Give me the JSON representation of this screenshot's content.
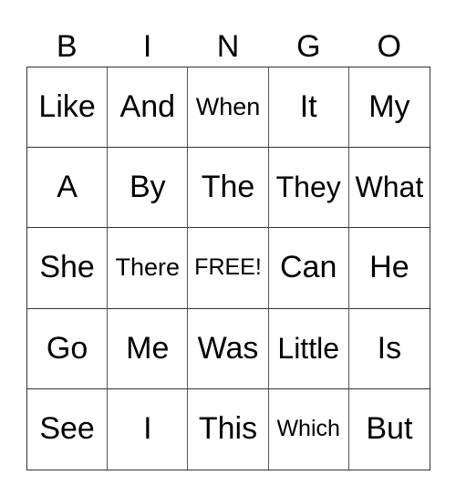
{
  "header": [
    "B",
    "I",
    "N",
    "G",
    "O"
  ],
  "cells": [
    [
      "Like",
      "And",
      "When",
      "It",
      "My"
    ],
    [
      "A",
      "By",
      "The",
      "They",
      "What"
    ],
    [
      "She",
      "There",
      "FREE!",
      "Can",
      "He"
    ],
    [
      "Go",
      "Me",
      "Was",
      "Little",
      "Is"
    ],
    [
      "See",
      "I",
      "This",
      "Which",
      "But"
    ]
  ]
}
